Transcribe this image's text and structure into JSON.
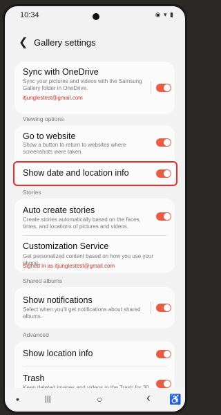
{
  "status_bar": {
    "time": "10:34",
    "icons": "◉ ▾ ▮"
  },
  "header": {
    "back_icon": "arrow-left",
    "title": "Gallery settings"
  },
  "sync": {
    "title": "Sync with OneDrive",
    "subtitle": "Sync your pictures and videos with the Samsung Gallery folder in OneDrive.",
    "account": "itjunglestest@gmail.com",
    "enabled": true
  },
  "viewing_options": {
    "header": "Viewing options",
    "go_to_website": {
      "title": "Go to website",
      "subtitle": "Show a button to return to websites where screenshots were taken.",
      "enabled": true
    },
    "show_date_location": {
      "title": "Show date and location info",
      "enabled": true
    }
  },
  "stories": {
    "header": "Stories",
    "auto_create": {
      "title": "Auto create stories",
      "subtitle": "Create stories automatically based on the faces, times, and locations of pictures and videos.",
      "enabled": true
    },
    "customization": {
      "title": "Customization Service",
      "subtitle": "Get personalized content based on how you use your phone.",
      "signed_in": "Signed in as itjunglestest@gmail.com"
    }
  },
  "shared_albums": {
    "header": "Shared albums",
    "show_notifications": {
      "title": "Show notifications",
      "subtitle": "Select when you'll get notifications about shared albums.",
      "enabled": true
    }
  },
  "advanced": {
    "header": "Advanced",
    "show_location": {
      "title": "Show location info",
      "enabled": true
    },
    "trash": {
      "title": "Trash",
      "subtitle": "Keep deleted images and videos in the Trash for 30",
      "enabled": true
    }
  },
  "nav": {
    "dot": "•",
    "recents": "|||",
    "home": "○",
    "back": "‹",
    "accessibility": "♿"
  },
  "colors": {
    "accent": "#ea5b44",
    "highlight": "#ee2b2b",
    "link": "#c0392b"
  }
}
